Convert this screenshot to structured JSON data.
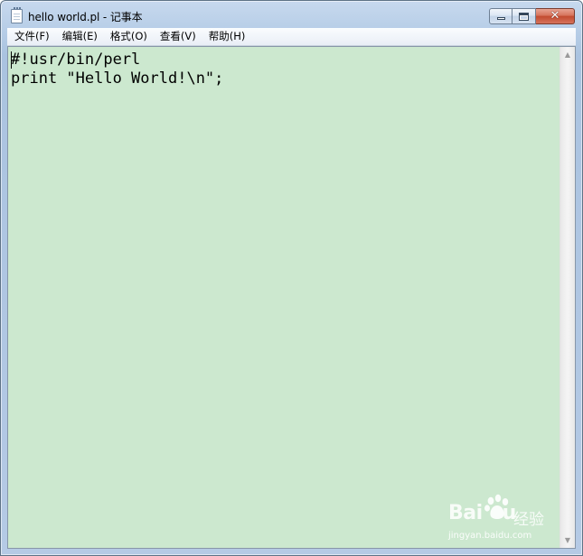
{
  "window": {
    "title": "hello world.pl - 记事本",
    "controls": {
      "minimize": "minimize",
      "maximize": "maximize",
      "close_glyph": "✕"
    }
  },
  "menu": {
    "items": [
      {
        "label": "文件(F)"
      },
      {
        "label": "编辑(E)"
      },
      {
        "label": "格式(O)"
      },
      {
        "label": "查看(V)"
      },
      {
        "label": "帮助(H)"
      }
    ]
  },
  "editor": {
    "content": "#!usr/bin/perl\nprint \"Hello World!\\n\";",
    "background": "#cce8cf"
  },
  "scrollbar": {
    "up_glyph": "▲",
    "down_glyph": "▼"
  },
  "watermark": {
    "brand_left": "Bai",
    "brand_right": "u",
    "brand_cn": "经验",
    "url": "jingyan.baidu.com"
  },
  "icons": {
    "app": "notepad-icon",
    "paw": "baidu-paw-icon"
  }
}
